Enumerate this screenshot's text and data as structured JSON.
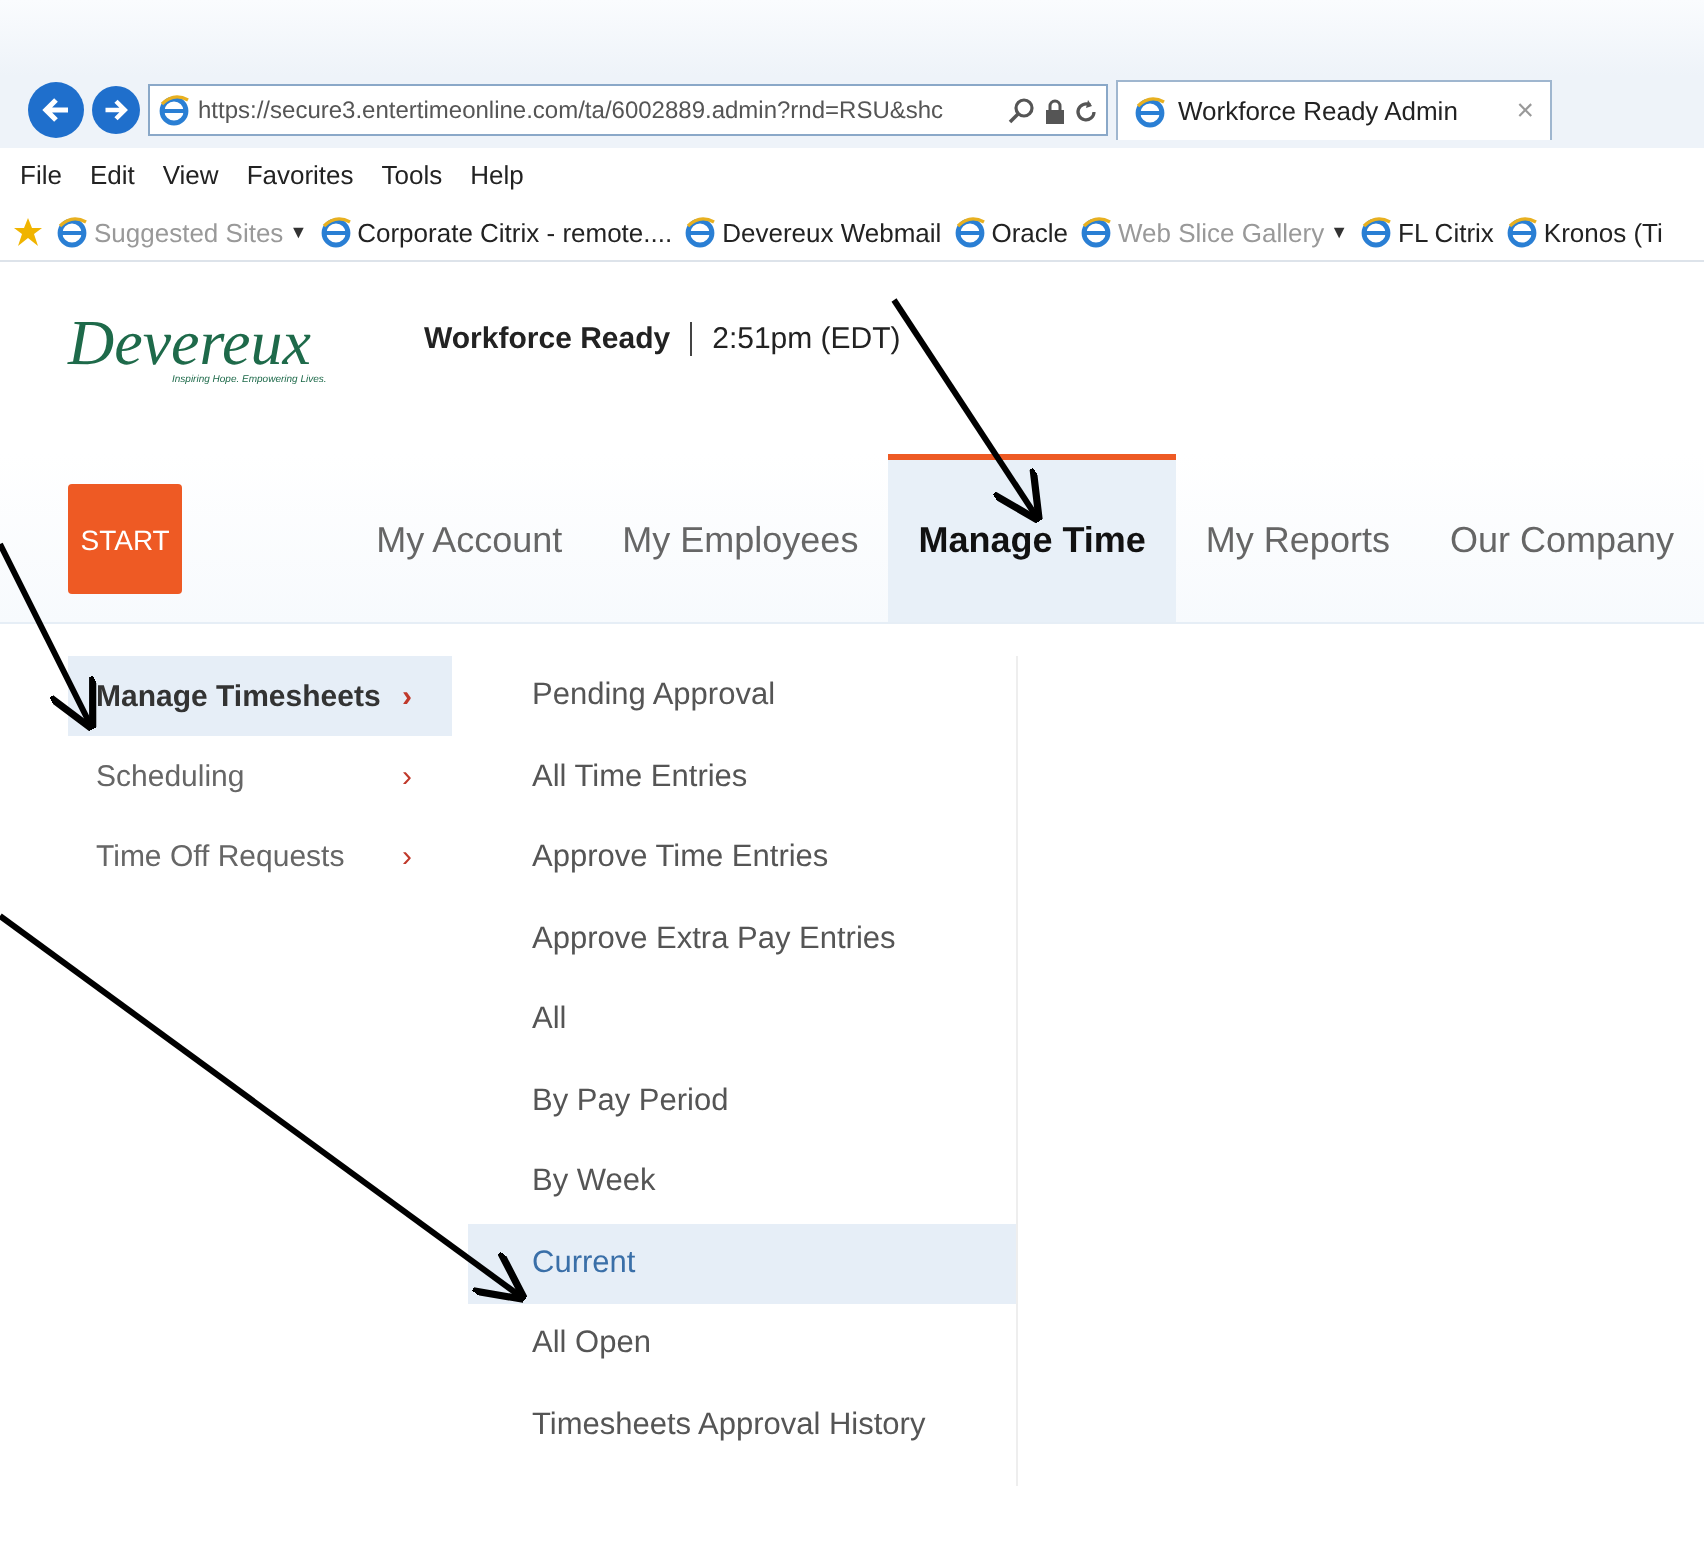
{
  "browser": {
    "address": "https://secure3.entertimeonline.com/ta/6002889.admin?rnd=RSU&shc",
    "tab_title": "Workforce Ready Admin",
    "tab_close": "×",
    "menu": [
      "File",
      "Edit",
      "View",
      "Favorites",
      "Tools",
      "Help"
    ],
    "favorites": [
      {
        "label": "Suggested Sites",
        "dimmed": true,
        "caret": "▼"
      },
      {
        "label": "Corporate Citrix - remote....",
        "dimmed": false
      },
      {
        "label": "Devereux Webmail",
        "dimmed": false
      },
      {
        "label": "Oracle",
        "dimmed": false
      },
      {
        "label": "Web Slice Gallery",
        "dimmed": true,
        "caret": "▼"
      },
      {
        "label": "FL Citrix",
        "dimmed": false
      },
      {
        "label": "Kronos (Ti",
        "dimmed": false
      }
    ]
  },
  "header": {
    "logo": "Devereux",
    "tagline": "Inspiring Hope. Empowering Lives.",
    "product": "Workforce Ready",
    "time": "2:51pm (EDT)"
  },
  "nav": {
    "start": "START",
    "items": [
      {
        "label": "My Account",
        "selected": false
      },
      {
        "label": "My Employees",
        "selected": false
      },
      {
        "label": "Manage Time",
        "selected": true
      },
      {
        "label": "My Reports",
        "selected": false
      },
      {
        "label": "Our Company",
        "selected": false
      }
    ]
  },
  "menu": {
    "items": [
      {
        "label": "Manage Timesheets",
        "chevron": "›",
        "selected": true
      },
      {
        "label": "Scheduling",
        "chevron": "›",
        "selected": false
      },
      {
        "label": "Time Off Requests",
        "chevron": "›",
        "selected": false
      }
    ],
    "submenu": [
      {
        "label": "Pending Approval",
        "selected": false
      },
      {
        "label": "All Time Entries",
        "selected": false
      },
      {
        "label": "Approve Time Entries",
        "selected": false
      },
      {
        "label": "Approve Extra Pay Entries",
        "selected": false
      },
      {
        "label": "All",
        "selected": false
      },
      {
        "label": "By Pay Period",
        "selected": false
      },
      {
        "label": "By Week",
        "selected": false
      },
      {
        "label": "Current",
        "selected": true
      },
      {
        "label": "All Open",
        "selected": false
      },
      {
        "label": "Timesheets Approval History",
        "selected": false
      }
    ]
  }
}
